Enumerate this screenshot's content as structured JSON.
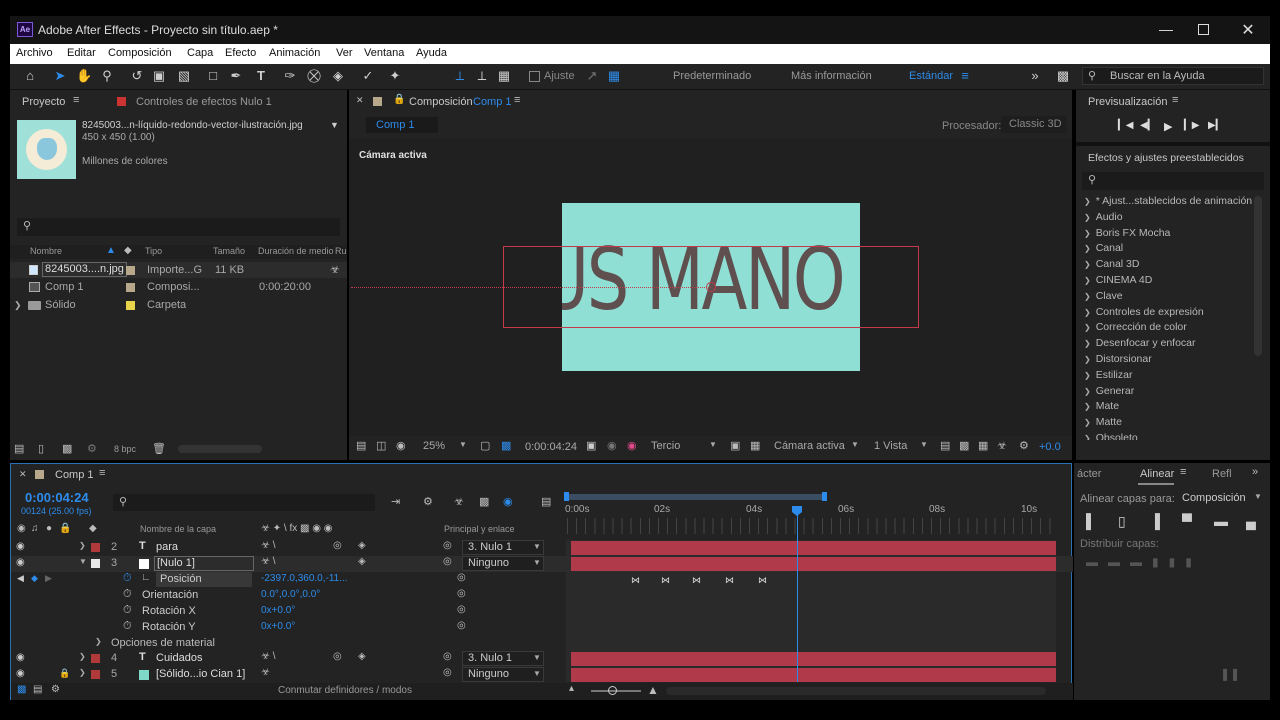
{
  "window": {
    "title": "Adobe After Effects - Proyecto sin título.aep *",
    "app_badge": "Ae"
  },
  "menu": [
    "Archivo",
    "Editar",
    "Composición",
    "Capa",
    "Efecto",
    "Animación",
    "Ver",
    "Ventana",
    "Ayuda"
  ],
  "toolbar": {
    "ajuste_label": "Ajuste",
    "workspaces": [
      "Predeterminado",
      "Más información",
      "Estándar"
    ],
    "search_placeholder": "Buscar en la Ayuda"
  },
  "project": {
    "tab_project": "Proyecto",
    "tab_effects": "Controles de efectos Nulo 1",
    "asset_name": "8245003...n-líquido-redondo-vector-ilustración.jpg",
    "asset_dims": "450 x 450 (1.00)",
    "asset_color": "Millones de colores",
    "columns": [
      "Nombre",
      "Tipo",
      "Tamaño",
      "Duración de medio",
      "Ru"
    ],
    "items": [
      {
        "name": "8245003....n.jpg",
        "type": "Importe...G",
        "size": "11 KB",
        "duration": "",
        "swatch": "#b7a88c"
      },
      {
        "name": "Comp 1",
        "type": "Composi...",
        "size": "",
        "duration": "0:00:20:00",
        "swatch": "#b7a88c"
      },
      {
        "name": "Sólido",
        "type": "Carpeta",
        "size": "",
        "duration": "",
        "swatch": "#e8d44b"
      }
    ],
    "bpc": "8 bpc"
  },
  "composition": {
    "tab": "Composición",
    "tab_comp": "Comp 1",
    "breadcrumb": "Comp 1",
    "renderer_label": "Procesador:",
    "renderer_value": "Classic 3D",
    "camera_label": "Cámara activa",
    "canvas_text": "US MANO",
    "zoom": "25%",
    "timecode": "0:00:04:24",
    "resolution": "Tercio",
    "view_camera": "Cámara activa",
    "views": "1 Vista",
    "exposure": "+0.0"
  },
  "preview": {
    "title": "Previsualización"
  },
  "effects_panel": {
    "title": "Efectos y ajustes preestablecidos",
    "items": [
      "* Ajust...stablecidos de animación",
      "Audio",
      "Boris FX Mocha",
      "Canal",
      "Canal 3D",
      "CINEMA 4D",
      "Clave",
      "Controles de expresión",
      "Corrección de color",
      "Desenfocar y enfocar",
      "Distorsionar",
      "Estilizar",
      "Generar",
      "Mate",
      "Matte",
      "Obsoleto"
    ]
  },
  "align_panel": {
    "tab_left": "ácter",
    "tab_active": "Alinear",
    "tab_right": "Refl",
    "align_to_label": "Alinear capas para:",
    "align_to_value": "Composición",
    "distribute_label": "Distribuir capas:"
  },
  "timeline": {
    "tab": "Comp 1",
    "timecode": "0:00:04:24",
    "frames": "00124 (25.00 fps)",
    "col_layer_name": "Nombre de la capa",
    "col_parent": "Principal y enlace",
    "ruler": [
      "0:00s",
      "02s",
      "04s",
      "06s",
      "08s",
      "10s"
    ],
    "layers": [
      {
        "num": "2",
        "kind": "T",
        "name": "para",
        "parent": "3. Nulo 1",
        "color": "#b03a3a"
      },
      {
        "num": "3",
        "kind": "",
        "name": "[Nulo 1]",
        "parent": "Ninguno",
        "color": "#e8e8e8"
      },
      {
        "num": "4",
        "kind": "T",
        "name": "Cuidados",
        "parent": "3. Nulo 1",
        "color": "#b03a3a"
      },
      {
        "num": "5",
        "kind": "",
        "name": "[Sólido...io Cian 1]",
        "parent": "Ninguno",
        "color": "#7fd8c8"
      }
    ],
    "props": [
      {
        "name": "Posición",
        "value": "-2397.0,360.0,-11..."
      },
      {
        "name": "Orientación",
        "value": "0.0°,0.0°,0.0°"
      },
      {
        "name": "Rotación X",
        "value": "0x+0.0°"
      },
      {
        "name": "Rotación Y",
        "value": "0x+0.0°"
      }
    ],
    "material_options": "Opciones de material",
    "footer_toggle": "Conmutar definidores / modos"
  }
}
